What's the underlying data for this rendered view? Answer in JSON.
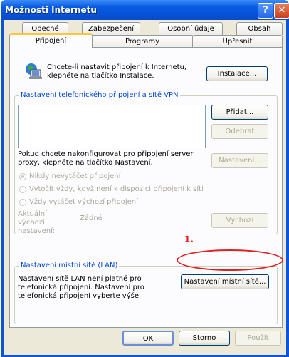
{
  "window": {
    "title": "Možnosti Internetu",
    "help_glyph": "?",
    "close_glyph": "✕"
  },
  "tabs_row1": [
    "Obecné",
    "Zabezpečení",
    "Osobní údaje",
    "Obsah"
  ],
  "tabs_row2": [
    "Připojení",
    "Programy",
    "Upřesnit"
  ],
  "setup": {
    "text": "Chcete-li nastavit připojení k Internetu, klepněte na tlačítko Instalace.",
    "button": "Instalace..."
  },
  "dialup": {
    "group_label": "Nastavení telefonického připojení a sítě VPN",
    "add_button": "Přidat...",
    "remove_button": "Odebrat",
    "proxy_text": "Pokud chcete nakonfigurovat pro připojení server proxy, klepněte na tlačítko Nastavení.",
    "settings_button": "Nastavení...",
    "options": [
      "Nikdy nevytáčet připojení",
      "Vytočit vždy, když není k dispozici připojení k síti",
      "Vždy vytáčet výchozí připojení"
    ],
    "default_label": "Aktuální výchozí nastavení:",
    "default_value": "Žádné",
    "default_button": "Výchozí"
  },
  "lan": {
    "group_label": "Nastavení místní sítě (LAN)",
    "text": "Nastavení sítě LAN není platné pro telefonická připojení. Nastavení pro telefonická připojení vyberte výše.",
    "button": "Nastavení místní sítě...",
    "annotation": "1."
  },
  "footer": {
    "ok": "OK",
    "cancel": "Storno",
    "apply": "Použít"
  },
  "colors": {
    "titlebar": "#0a5ce4",
    "group_label": "#0046d5",
    "annotation": "#e02020"
  }
}
